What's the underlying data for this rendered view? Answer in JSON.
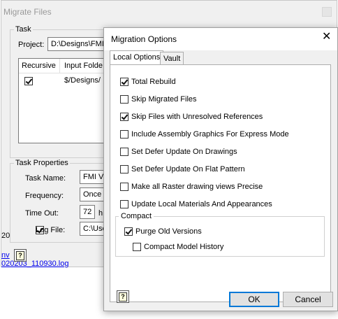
{
  "background_dialog": {
    "title": "Migrate Files",
    "task_group_label": "Task",
    "project_label": "Project:",
    "project_value": "D:\\Designs\\FMI V",
    "table_headers": [
      "Recursive",
      "Input Folde"
    ],
    "table_rows": [
      {
        "recursive": true,
        "input_folder": "$/Designs/"
      }
    ],
    "task_properties_label": "Task Properties",
    "task_name_label": "Task Name:",
    "task_name_value": "FMI Va",
    "frequency_label": "Frequency:",
    "frequency_value": "Once",
    "timeout_label": "Time Out:",
    "timeout_value": "72",
    "timeout_unit": "h",
    "logfile_label": "Log File:",
    "logfile_checked": true,
    "logfile_value": "C:\\Use",
    "left_fragment": "20",
    "link_line1": "nv",
    "link_line2": "020203_110930.log"
  },
  "migration_options": {
    "title": "Migration Options",
    "close_glyph": "✕",
    "tabs": [
      {
        "label": "Local Options",
        "active": true
      },
      {
        "label": "Vault",
        "active": false
      }
    ],
    "options": [
      {
        "label": "Total Rebuild",
        "checked": true
      },
      {
        "label": "Skip Migrated Files",
        "checked": false
      },
      {
        "label": "Skip Files with Unresolved References",
        "checked": true
      },
      {
        "label": "Include Assembly Graphics For Express Mode",
        "checked": false
      },
      {
        "label": "Set Defer Update On Drawings",
        "checked": false
      },
      {
        "label": "Set Defer Update On Flat Pattern",
        "checked": false
      },
      {
        "label": "Make all Raster drawing views Precise",
        "checked": false
      },
      {
        "label": "Update Local Materials And Appearances",
        "checked": false
      }
    ],
    "compact_group": {
      "label": "Compact",
      "options": [
        {
          "label": "Purge Old Versions",
          "checked": true
        },
        {
          "label": "Compact Model History",
          "checked": false
        }
      ]
    },
    "ok_label": "OK",
    "cancel_label": "Cancel",
    "help_icon": "help-icon"
  },
  "colors": {
    "dialog_bg": "#f0f0f0",
    "primary_border": "#0078d7",
    "link": "#0000ee"
  }
}
